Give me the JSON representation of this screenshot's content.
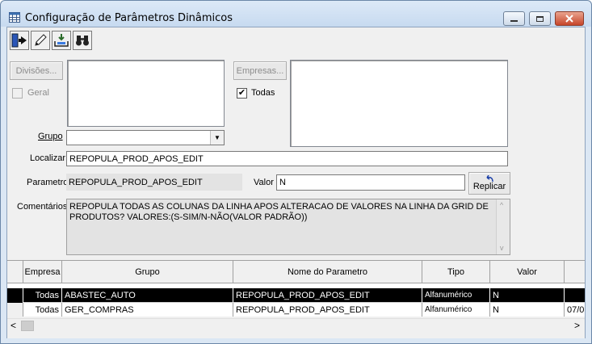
{
  "window": {
    "title": "Configuração de Parâmetros Dinâmicos"
  },
  "toolbar": {
    "icons": [
      "exit-icon",
      "edit-icon",
      "save-icon",
      "search-binoculars-icon"
    ]
  },
  "divisoes": {
    "button_label": "Divisões...",
    "geral_label": "Geral",
    "geral_checked": false
  },
  "empresas": {
    "button_label": "Empresas...",
    "todas_label": "Todas",
    "todas_checked": true,
    "check_mark": "✔"
  },
  "grupo": {
    "label": "Grupo",
    "value": ""
  },
  "localizar": {
    "label": "Localizar",
    "value": "REPOPULA_PROD_APOS_EDIT"
  },
  "parametro": {
    "label": "Parametro",
    "value": "REPOPULA_PROD_APOS_EDIT"
  },
  "valor": {
    "label": "Valor",
    "value": "N"
  },
  "replicar": {
    "label": "Replicar"
  },
  "comentarios": {
    "label": "Comentários",
    "text": "REPOPULA TODAS AS COLUNAS DA LINHA APOS ALTERACAO DE VALORES NA LINHA DA GRID DE PRODUTOS? VALORES:(S-SIM/N-NÃO(VALOR PADRÃO))"
  },
  "grid": {
    "columns": [
      "Empresa",
      "Grupo",
      "Nome do Parametro",
      "Tipo",
      "Valor",
      ""
    ],
    "rows": [
      {
        "empresa": "Todas",
        "grupo": "ABASTEC_AUTO",
        "nome": "REPOPULA_PROD_APOS_EDIT",
        "tipo": "Alfanumérico",
        "valor": "N",
        "extra": "",
        "selected": true
      },
      {
        "empresa": "Todas",
        "grupo": "GER_COMPRAS",
        "nome": "REPOPULA_PROD_APOS_EDIT",
        "tipo": "Alfanumérico",
        "valor": "N",
        "extra": "07/0",
        "selected": false
      }
    ]
  },
  "scrollbar": {
    "left_arrow": "<",
    "right_arrow": ">",
    "up_arrow": "^",
    "down_arrow": "v",
    "dropdown_arrow": "▼"
  },
  "colors": {
    "selection": "#000000",
    "window_frame": "#dbe7f4",
    "close_button": "#c7452a"
  }
}
